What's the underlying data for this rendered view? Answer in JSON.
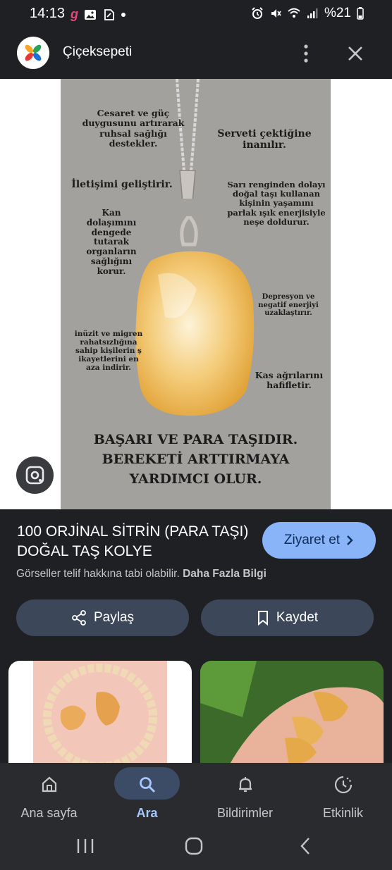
{
  "status_bar": {
    "time": "14:13",
    "battery": "%21",
    "left_icons": [
      "g-app-icon",
      "gallery-icon",
      "notes-icon",
      "dot-icon"
    ],
    "right_icons": [
      "alarm-icon",
      "mute-icon",
      "wifi-icon",
      "signal-icon",
      "battery-icon"
    ]
  },
  "header": {
    "title": "Çiçeksepeti",
    "more_icon": "more-vert-icon",
    "close_icon": "close-icon"
  },
  "poster": {
    "left_texts": [
      "Cesaret ve güç duygusunu artırarak ruhsal sağlığı destekler.",
      "İletişimi geliştirir.",
      "Kan dolaşımını dengede tutarak organların sağlığını korur.",
      "inüzit ve migren rahatsızlığına sahip kişilerin ş ikayetlerini en aza indirir."
    ],
    "right_texts": [
      "Serveti çektiğine inanılır.",
      "Sarı renginden dolayı doğal taşı kullanan kişinin yaşamını parlak ışık enerjisiyle neşe doldurur.",
      "Depresyon ve negatif enerjiyi uzaklaştırır.",
      "Kas ağrılarını hafifletir."
    ],
    "bottom_line1": "BAŞARI VE PARA TAŞIDIR.",
    "bottom_line2": "BEREKETİ ARTTIRMAYA",
    "bottom_line3": "YARDIMCI OLUR."
  },
  "product": {
    "title": "100 ORJİNAL SİTRİN (PARA TAŞI) DOĞAL TAŞ KOLYE",
    "visit_label": "Ziyaret et",
    "copyright_text": "Görseller telif hakkına tabi olabilir.",
    "more_info_link": "Daha Fazla Bilgi"
  },
  "actions": {
    "share_label": "Paylaş",
    "save_label": "Kaydet"
  },
  "bottom_nav": {
    "items": [
      {
        "label": "Ana sayfa",
        "icon": "home-icon"
      },
      {
        "label": "Ara",
        "icon": "search-icon",
        "active": true
      },
      {
        "label": "Bildirimler",
        "icon": "bell-icon"
      },
      {
        "label": "Etkinlik",
        "icon": "activity-icon"
      }
    ]
  },
  "colors": {
    "background": "#1f2023",
    "accent": "#8ab4f8",
    "button_bg": "#3c4759",
    "active_nav": "#a8c7fa"
  }
}
